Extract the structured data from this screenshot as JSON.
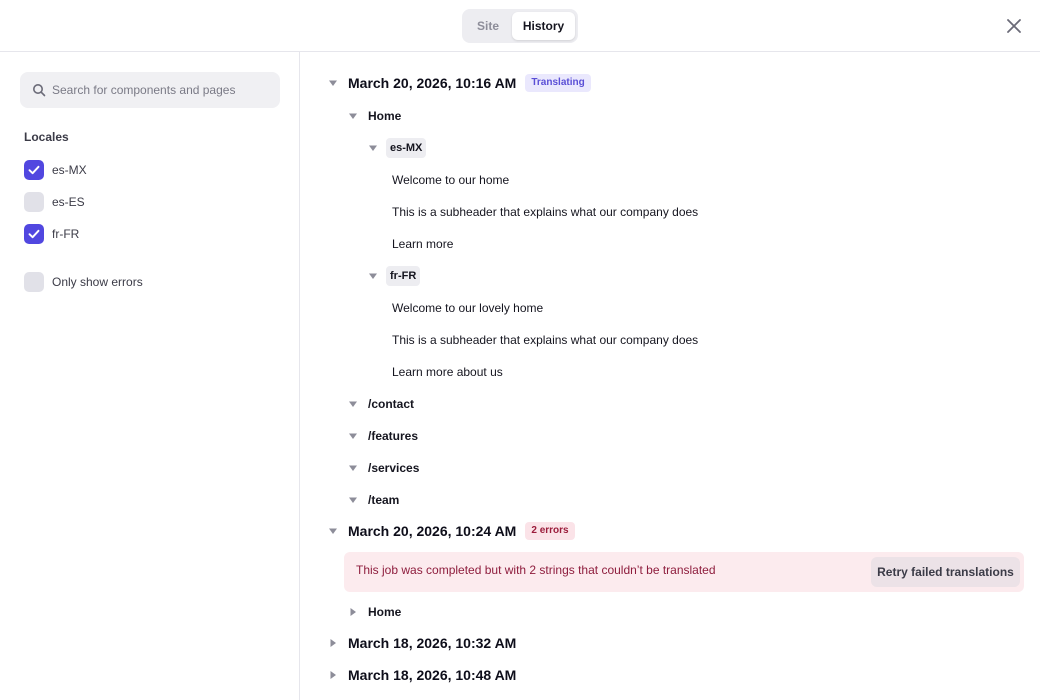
{
  "header": {
    "tabs": [
      {
        "label": "Site",
        "active": false
      },
      {
        "label": "History",
        "active": true
      }
    ],
    "close_icon": "close-icon"
  },
  "sidebar": {
    "search": {
      "placeholder": "Search for components and pages",
      "value": "",
      "icon": "search-icon"
    },
    "locales_title": "Locales",
    "locales": [
      {
        "label": "es-MX",
        "checked": true
      },
      {
        "label": "es-ES",
        "checked": false
      },
      {
        "label": "fr-FR",
        "checked": true
      }
    ],
    "only_errors": {
      "label": "Only show errors",
      "checked": false
    }
  },
  "colors": {
    "accent": "#5147e0",
    "error_bg": "#fcebee",
    "error_text": "#8e1d3d",
    "badge_blue_bg": "#eae8fd",
    "badge_red_bg": "#fbe3e8"
  },
  "jobs": [
    {
      "title": "March 20, 2026, 10:16 AM",
      "badge": "Translating",
      "expanded": true,
      "home": {
        "label": "Home",
        "locales": [
          {
            "code": "es-MX",
            "strings": [
              "Welcome to our home",
              "This is a subheader that explains what our company does",
              "Learn more"
            ]
          },
          {
            "code": "fr-FR",
            "strings": [
              "Welcome to our lovely home",
              "This is a subheader that explains what our company does",
              "Learn more about us"
            ]
          }
        ]
      },
      "pages": [
        "/contact",
        "/features",
        "/services",
        "/team"
      ]
    },
    {
      "title": "March 20, 2026, 10:24 AM",
      "badge": "2 errors",
      "expanded": true,
      "error_message": "This job was completed but with 2 strings that couldn’t be translated",
      "retry_label": "Retry failed translations",
      "pages": [
        "Home"
      ]
    },
    {
      "title": "March 18, 2026, 10:32 AM",
      "expanded": false
    },
    {
      "title": "March 18, 2026, 10:48 AM",
      "expanded": false
    }
  ]
}
